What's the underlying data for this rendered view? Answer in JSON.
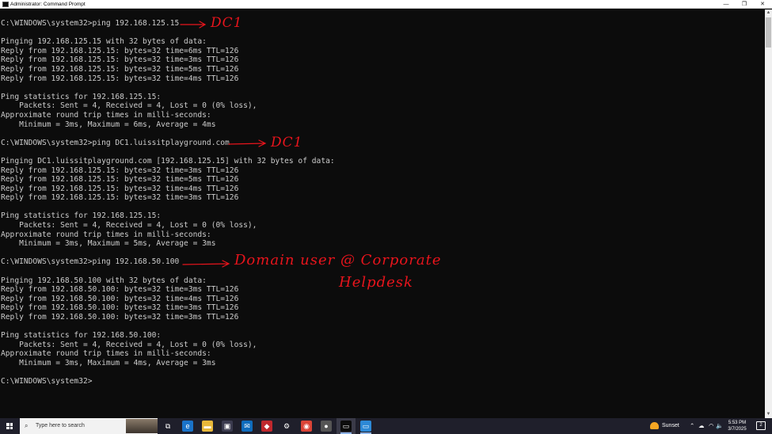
{
  "window": {
    "title": "Administrator: Command Prompt",
    "minimize_glyph": "—",
    "maximize_glyph": "❐",
    "close_glyph": "✕"
  },
  "console": {
    "lines": [
      "C:\\WINDOWS\\system32>ping 192.168.125.15",
      "",
      "Pinging 192.168.125.15 with 32 bytes of data:",
      "Reply from 192.168.125.15: bytes=32 time=6ms TTL=126",
      "Reply from 192.168.125.15: bytes=32 time=3ms TTL=126",
      "Reply from 192.168.125.15: bytes=32 time=5ms TTL=126",
      "Reply from 192.168.125.15: bytes=32 time=4ms TTL=126",
      "",
      "Ping statistics for 192.168.125.15:",
      "    Packets: Sent = 4, Received = 4, Lost = 0 (0% loss),",
      "Approximate round trip times in milli-seconds:",
      "    Minimum = 3ms, Maximum = 6ms, Average = 4ms",
      "",
      "C:\\WINDOWS\\system32>ping DC1.luissitplayground.com",
      "",
      "Pinging DC1.luissitplayground.com [192.168.125.15] with 32 bytes of data:",
      "Reply from 192.168.125.15: bytes=32 time=3ms TTL=126",
      "Reply from 192.168.125.15: bytes=32 time=5ms TTL=126",
      "Reply from 192.168.125.15: bytes=32 time=4ms TTL=126",
      "Reply from 192.168.125.15: bytes=32 time=3ms TTL=126",
      "",
      "Ping statistics for 192.168.125.15:",
      "    Packets: Sent = 4, Received = 4, Lost = 0 (0% loss),",
      "Approximate round trip times in milli-seconds:",
      "    Minimum = 3ms, Maximum = 5ms, Average = 3ms",
      "",
      "C:\\WINDOWS\\system32>ping 192.168.50.100",
      "",
      "Pinging 192.168.50.100 with 32 bytes of data:",
      "Reply from 192.168.50.100: bytes=32 time=3ms TTL=126",
      "Reply from 192.168.50.100: bytes=32 time=4ms TTL=126",
      "Reply from 192.168.50.100: bytes=32 time=3ms TTL=126",
      "Reply from 192.168.50.100: bytes=32 time=3ms TTL=126",
      "",
      "Ping statistics for 192.168.50.100:",
      "    Packets: Sent = 4, Received = 4, Lost = 0 (0% loss),",
      "Approximate round trip times in milli-seconds:",
      "    Minimum = 3ms, Maximum = 4ms, Average = 3ms",
      "",
      "C:\\WINDOWS\\system32>"
    ],
    "text_color": "#cccccc",
    "background": "#0c0c0c"
  },
  "annotations": {
    "color": "#e8141c",
    "note1": "DC1",
    "note2": "DC1",
    "note3_line1": "Domain user @ Corporate",
    "note3_line2": "Helpdesk"
  },
  "taskbar": {
    "search_placeholder": "Type here to search",
    "search_icon": "magnifier-icon",
    "pinned": [
      {
        "name": "task-view-icon",
        "glyph": "⧉",
        "color": "#1f1f2b"
      },
      {
        "name": "edge-icon",
        "glyph": "e",
        "color": "#1a73c9"
      },
      {
        "name": "file-explorer-icon",
        "glyph": "▬",
        "color": "#e8b83a"
      },
      {
        "name": "store-icon",
        "glyph": "▣",
        "color": "#3b3b4f"
      },
      {
        "name": "mail-icon",
        "glyph": "✉",
        "color": "#0f6cbd"
      },
      {
        "name": "remote-tool-icon",
        "glyph": "◆",
        "color": "#c0282d"
      },
      {
        "name": "settings-icon",
        "glyph": "⚙",
        "color": "#1f1f2b"
      },
      {
        "name": "chrome-icon",
        "glyph": "◉",
        "color": "#db4437"
      },
      {
        "name": "app-icon",
        "glyph": "●",
        "color": "#555555"
      },
      {
        "name": "command-prompt-icon",
        "glyph": "▭",
        "color": "#0c0c0c"
      },
      {
        "name": "rdp-icon",
        "glyph": "▭",
        "color": "#2d89d6"
      }
    ],
    "weather_label": "Sunset",
    "tray_chevron": "⌃",
    "tray_cloud": "☁",
    "tray_network": "◠",
    "tray_volume": "🔈",
    "clock_time": "5:53 PM",
    "clock_date": "3/7/2025",
    "notification_count": "2"
  }
}
